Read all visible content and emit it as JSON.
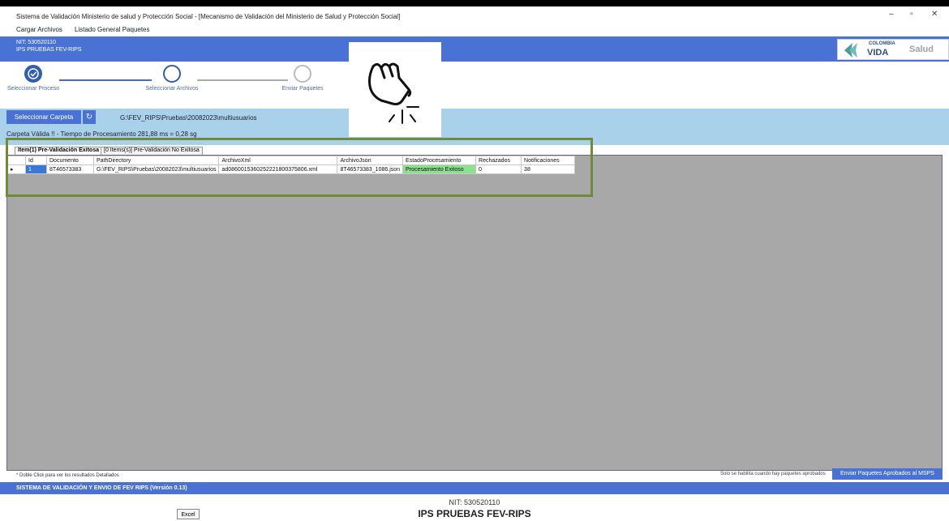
{
  "window": {
    "title": "Sistema de Validación Ministerio de salud y Protección Social - [Mecanismo de Validación del Ministerio de Salud y Protección Social]",
    "minimize": "–",
    "restore": "▫",
    "close": "✕"
  },
  "menu": {
    "items": [
      "Cargar Archivos",
      "Listado General Paquetes"
    ]
  },
  "info": {
    "nit": "NIT: 530520110",
    "org": "IPS PRUEBAS FEV-RIPS",
    "logo_text1": "COLOMBIA",
    "logo_text2": "VIDA",
    "logo_text3": "Salud"
  },
  "wizard": {
    "steps": [
      {
        "label": "Seleccionar Proceso",
        "state": "done"
      },
      {
        "label": "Seleccionar Archivos",
        "state": "active"
      },
      {
        "label": "Enviar Paquetes",
        "state": "pending"
      }
    ]
  },
  "folder": {
    "button_label": "Seleccionar Carpeta",
    "path": "G:\\FEV_RIPS\\Pruebas\\20082023\\multiusuarios",
    "summary": "Carpeta Válida !! - Tiempo de Procesamiento 281,88 ms = 0,28 sg"
  },
  "tabs": {
    "success": "Item(1) Pre-Validación Exitosa",
    "failed": "[0 Items(s)] Pre-Validación No Exitosa"
  },
  "table": {
    "columns": [
      "Id",
      "Documento",
      "PathDirectory",
      "ArchivoXml",
      "ArchivoJson",
      "EstadoProcesamiento",
      "Rechazados",
      "Notificaciones"
    ],
    "rows": [
      [
        "1",
        "8T46573383",
        "G:\\FEV_RIPS\\Pruebas\\20082023\\multiusuarios",
        "ad0860015360252221800375806.xml",
        "8T46573383_1086.json",
        "Procesamiento Exitoso",
        "0",
        "38"
      ]
    ]
  },
  "footer": {
    "hint": "* Doble Click para ver los resultados Detallados",
    "send_note": "Solo se habilita cuando hay paquetes aprobados",
    "send_button": "Enviar Paquetes Aprobados al MSPS",
    "status": "SISTEMA DE VALIDACIÓN Y ENVIO DE FEV RIPS (Versión 0.13)",
    "nit": "NIT: 530520110",
    "org": "IPS PRUEBAS FEV-RIPS",
    "excel": "Excel"
  },
  "colors": {
    "accent": "#4a72d4",
    "success_cell": "#8de08d",
    "highlight": "#6f8b3a"
  }
}
